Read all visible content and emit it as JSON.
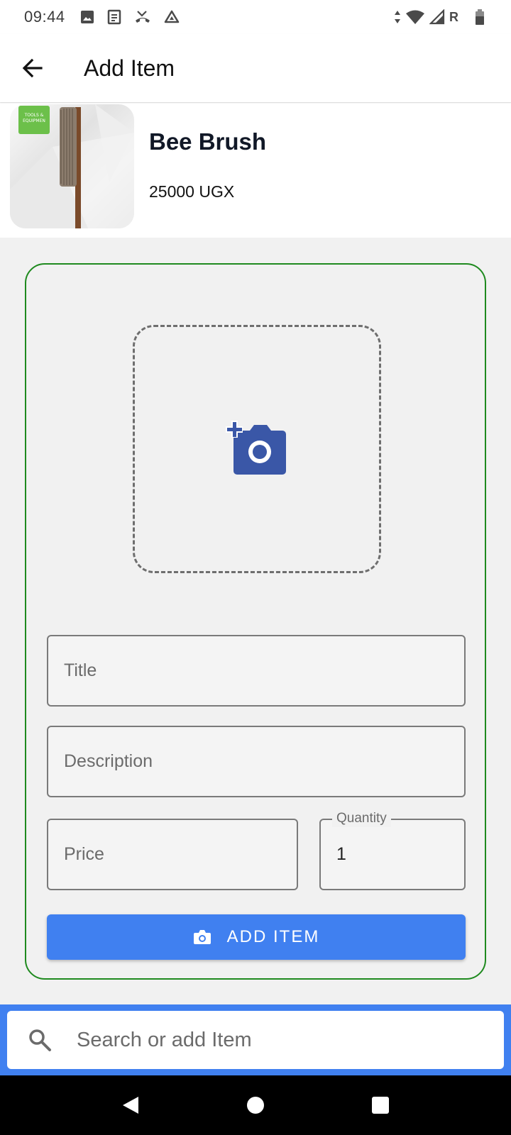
{
  "status_bar": {
    "time": "09:44",
    "carrier_letter": "R",
    "icons": [
      "image-icon",
      "news-icon",
      "missed-call-icon",
      "drive-icon",
      "data-arrows-icon",
      "wifi-icon",
      "signal-icon",
      "battery-icon"
    ]
  },
  "app_bar": {
    "title": "Add Item",
    "back_icon": "arrow-left-icon"
  },
  "product": {
    "name": "Bee Brush",
    "price": "25000 UGX",
    "badge_text": "TOOLS & EQUIPMEN"
  },
  "form": {
    "photo_icon": "add-photo-icon",
    "title_placeholder": "Title",
    "description_placeholder": "Description",
    "price_placeholder": "Price",
    "quantity_label": "Quantity",
    "quantity_value": "1",
    "submit_label": "ADD ITEM",
    "submit_icon": "camera-icon"
  },
  "search": {
    "placeholder": "Search or add Item",
    "icon": "search-icon"
  },
  "nav_bar": {
    "buttons": [
      "back-triangle-icon",
      "home-circle-icon",
      "recents-square-icon"
    ]
  },
  "colors": {
    "accent_blue": "#4080f0",
    "card_border_green": "#1f8a1f",
    "photo_icon_blue": "#3a57a7",
    "background_grey": "#f1f1f1"
  }
}
